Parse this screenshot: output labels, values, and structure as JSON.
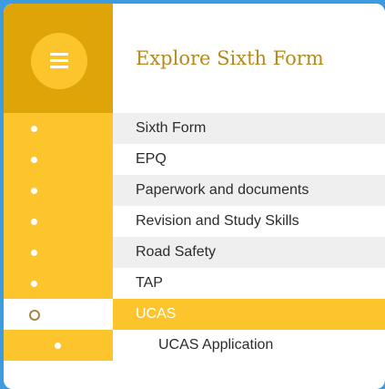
{
  "header": {
    "title": "Explore Sixth Form",
    "menu_icon": "hamburger-menu-icon"
  },
  "nav": {
    "items": [
      {
        "label": "Sixth Form"
      },
      {
        "label": "EPQ"
      },
      {
        "label": "Paperwork and documents"
      },
      {
        "label": "Revision and Study Skills"
      },
      {
        "label": "Road Safety"
      },
      {
        "label": "TAP"
      },
      {
        "label": "UCAS"
      }
    ],
    "sub_items": [
      {
        "label": "UCAS Application"
      }
    ],
    "active_item": "UCAS"
  },
  "colors": {
    "accent_yellow": "#fcc52c",
    "header_gold": "#dea408",
    "title_text": "#b48a1f",
    "row_shade": "#efeff0",
    "frame_blue": "#3f9be0"
  }
}
